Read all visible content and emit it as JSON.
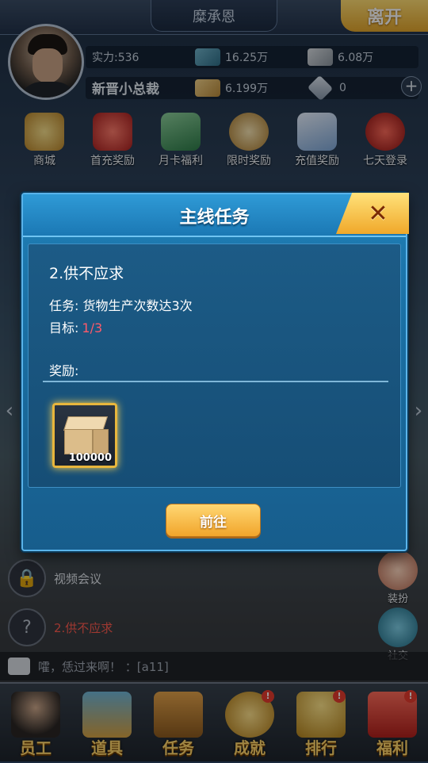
{
  "top": {
    "name": "糜承恩",
    "leave": "离开"
  },
  "player": {
    "strength": "实力:536",
    "title": "新晋小总裁",
    "cash": "16.25万",
    "stock": "6.08万",
    "goods": "6.199万",
    "diamonds": "0"
  },
  "menu": [
    {
      "label": "商城"
    },
    {
      "label": "首充奖励"
    },
    {
      "label": "月卡福利"
    },
    {
      "label": "限时奖励"
    },
    {
      "label": "充值奖励"
    },
    {
      "label": "七天登录"
    }
  ],
  "side": {
    "video_meeting": "视频会议",
    "task_hint": "2.供不应求",
    "dress_up": "装扮",
    "social": "社交"
  },
  "chat": {
    "text": "嚯，恁过来啊！ ：[a11]"
  },
  "bottom_nav": [
    {
      "label": "员工"
    },
    {
      "label": "道具"
    },
    {
      "label": "任务"
    },
    {
      "label": "成就"
    },
    {
      "label": "排行"
    },
    {
      "label": "福利"
    }
  ],
  "dialog": {
    "title": "主线任务",
    "task_title": "2.供不应求",
    "task_desc": "任务: 货物生产次数达3次",
    "goal_label": "目标:",
    "goal_value": "1/3",
    "reward_label": "奖励:",
    "reward_qty": "100000",
    "go_button": "前往"
  },
  "colors": {
    "dialog_blue": "#1a6ea2",
    "gold": "#f1a52b",
    "goal_red": "#ff5a6a"
  }
}
